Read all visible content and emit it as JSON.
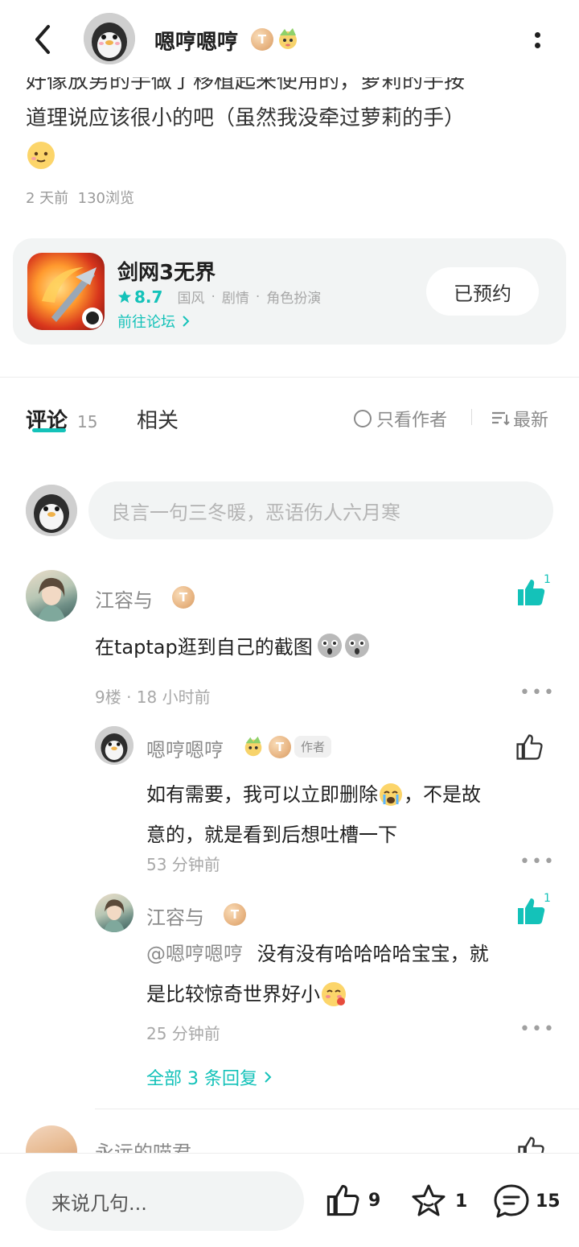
{
  "header": {
    "username": "嗯哼嗯哼",
    "badge_letter": "T",
    "badge_level": "5"
  },
  "post": {
    "cut_line": "好像放男的手做了移植起来使用的，萝莉的手按",
    "line2": "道理说应该很小的吧（虽然我没牵过萝莉的手）",
    "meta_time": "2 天前",
    "meta_views": "130浏览"
  },
  "game_card": {
    "name": "剑网3无界",
    "rating": "8.7",
    "tags": [
      "国风",
      "剧情",
      "角色扮演"
    ],
    "forum_link": "前往论坛",
    "reserve_label": "已预约"
  },
  "tabs": {
    "comments_label": "评论",
    "comments_count": "15",
    "related_label": "相关",
    "author_only": "只看作者",
    "sort_label": "最新"
  },
  "comment_input": {
    "placeholder": "良言一句三冬暖，恶语伤人六月寒"
  },
  "comments": [
    {
      "user": "江容与",
      "badge": "T",
      "badge_level": "5",
      "likes": "1",
      "text": "在taptap逛到自己的截图",
      "floor_meta": "9楼 · 18 小时前",
      "replies": [
        {
          "user": "嗯哼嗯哼",
          "author_tag": "作者",
          "text1": "如有需要，我可以立即删除",
          "text2": "，不是故",
          "text3": "意的，就是看到后想吐槽一下",
          "time": "53 分钟前"
        },
        {
          "user": "江容与",
          "likes": "1",
          "mention": "@嗯哼嗯哼",
          "text1": "没有没有哈哈哈哈宝宝，就",
          "text2": "是比较惊奇世界好小",
          "time": "25 分钟前"
        }
      ],
      "all_replies": "全部 3 条回复"
    },
    {
      "user": "永远的喵君"
    }
  ],
  "bottom_bar": {
    "input_placeholder": "来说几句...",
    "likes": "9",
    "favorites": "1",
    "comments": "15"
  },
  "colors": {
    "accent": "#14c2b9",
    "card_bg": "#f2f4f4",
    "muted": "#9a9a9a"
  }
}
